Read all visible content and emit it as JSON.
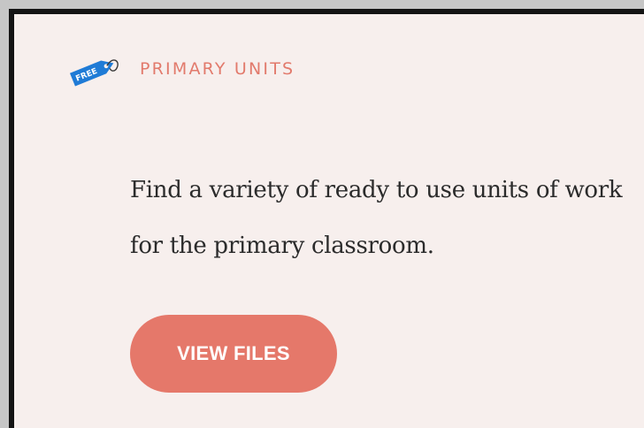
{
  "section": {
    "title": "PRIMARY UNITS",
    "tag_text": "FREE",
    "icon": "free-tag-icon",
    "description": "Find a variety of ready to use units of work for the primary classroom.",
    "button_label": "VIEW FILES"
  },
  "colors": {
    "card_background": "#f7efed",
    "accent": "#e5786a",
    "tag_blue": "#1f7bd6",
    "text": "#2b2b2b"
  }
}
